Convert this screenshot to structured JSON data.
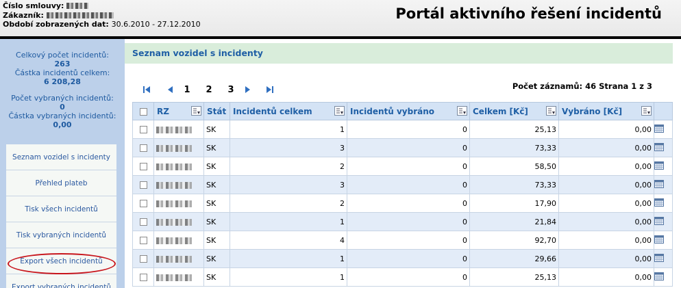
{
  "header": {
    "contract_label": "Číslo smlouvy:",
    "customer_label": "Zákazník:",
    "period_label": "Období zobrazených dat:",
    "period_value": "30.6.2010 - 27.12.2010",
    "title": "Portál aktivního řešení incidentů"
  },
  "sidebar": {
    "stats": {
      "total_count_label": "Celkový počet incidentů:",
      "total_count_value": "263",
      "total_amount_label": "Částka incidentů celkem:",
      "total_amount_value": "6 208,28",
      "selected_count_label": "Počet vybraných incidentů:",
      "selected_count_value": "0",
      "selected_amount_label": "Částka vybraných incidentů:",
      "selected_amount_value": "0,00"
    },
    "menu": [
      "Seznam vozidel s incidenty",
      "Přehled plateb",
      "Tisk všech incidentů",
      "Tisk vybraných incidentů",
      "Export všech incidentů",
      "Export vybraných incidentů"
    ]
  },
  "main": {
    "section_title": "Seznam vozidel s incidenty",
    "pager": {
      "pages": [
        "1",
        "2",
        "3"
      ]
    },
    "records_info": "Počet záznamů: 46 Strana 1 z 3",
    "columns": [
      "RZ",
      "Stát",
      "Incidentů celkem",
      "Incidentů vybráno",
      "Celkem [Kč]",
      "Vybráno [Kč]"
    ],
    "rows": [
      {
        "state": "SK",
        "total": "1",
        "selected": "0",
        "amount": "25,13",
        "selected_amount": "0,00"
      },
      {
        "state": "SK",
        "total": "3",
        "selected": "0",
        "amount": "73,33",
        "selected_amount": "0,00"
      },
      {
        "state": "SK",
        "total": "2",
        "selected": "0",
        "amount": "58,50",
        "selected_amount": "0,00"
      },
      {
        "state": "SK",
        "total": "3",
        "selected": "0",
        "amount": "73,33",
        "selected_amount": "0,00"
      },
      {
        "state": "SK",
        "total": "2",
        "selected": "0",
        "amount": "17,90",
        "selected_amount": "0,00"
      },
      {
        "state": "SK",
        "total": "1",
        "selected": "0",
        "amount": "21,84",
        "selected_amount": "0,00"
      },
      {
        "state": "SK",
        "total": "4",
        "selected": "0",
        "amount": "92,70",
        "selected_amount": "0,00"
      },
      {
        "state": "SK",
        "total": "1",
        "selected": "0",
        "amount": "29,66",
        "selected_amount": "0,00"
      },
      {
        "state": "SK",
        "total": "1",
        "selected": "0",
        "amount": "25,13",
        "selected_amount": "0,00"
      }
    ]
  },
  "colors": {
    "accent": "#1f5fa5",
    "sidebar": "#bcd0ea",
    "highlight_circle": "#c8161d"
  }
}
